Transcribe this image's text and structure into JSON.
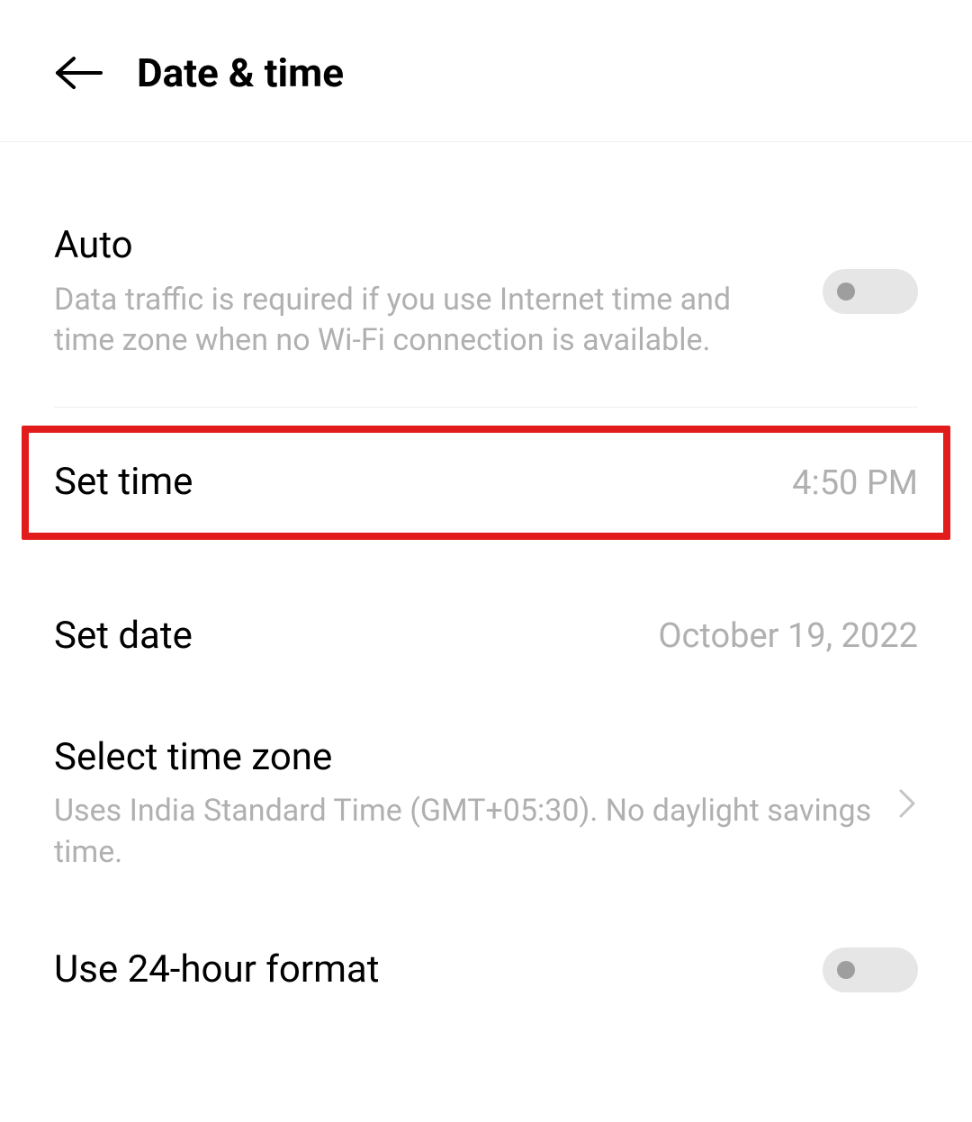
{
  "header": {
    "title": "Date & time"
  },
  "settings": {
    "auto": {
      "label": "Auto",
      "description": "Data traffic is required if you use Internet time and time zone when no Wi-Fi connection is available.",
      "enabled": false
    },
    "set_time": {
      "label": "Set time",
      "value": "4:50 PM"
    },
    "set_date": {
      "label": "Set date",
      "value": "October 19, 2022"
    },
    "timezone": {
      "label": "Select time zone",
      "description": "Uses India Standard Time (GMT+05:30). No daylight savings time."
    },
    "use_24h": {
      "label": "Use 24-hour format",
      "enabled": false
    }
  }
}
